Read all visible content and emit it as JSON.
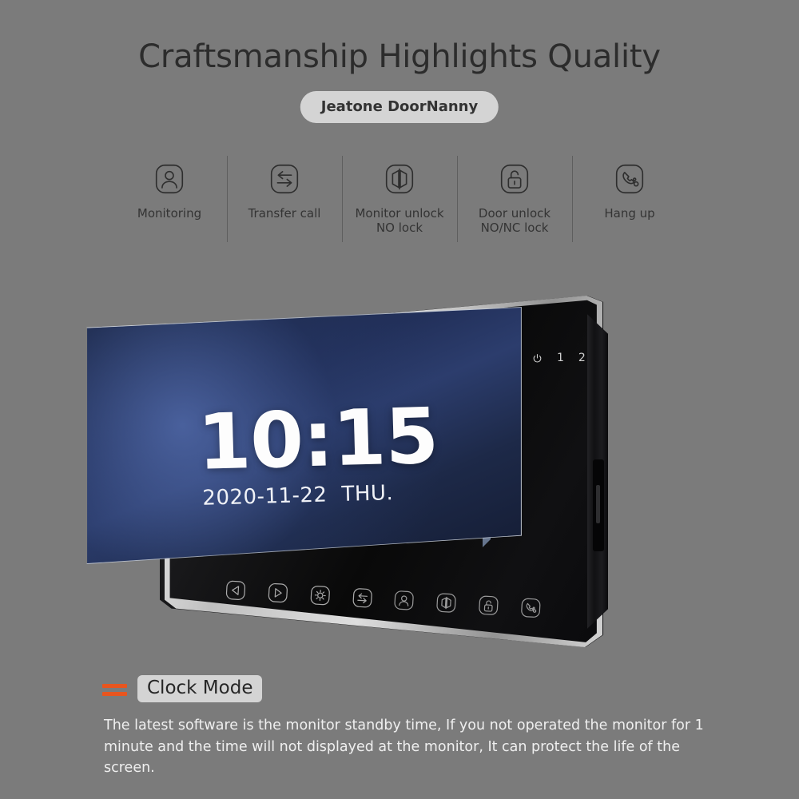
{
  "header": {
    "title": "Craftsmanship Highlights Quality",
    "badge": "Jeatone DoorNanny"
  },
  "features": [
    {
      "icon": "person-monitor-icon",
      "label": "Monitoring"
    },
    {
      "icon": "transfer-arrows-icon",
      "label": "Transfer call"
    },
    {
      "icon": "double-door-icon",
      "label": "Monitor unlock\nNO lock"
    },
    {
      "icon": "padlock-open-icon",
      "label": "Door unlock\nNO/NC lock"
    },
    {
      "icon": "phone-handset-icon",
      "label": "Hang up"
    }
  ],
  "device": {
    "screen": {
      "time": "10:15",
      "date": "2020-11-22",
      "day_of_week": "THU."
    },
    "indicators": {
      "power_icon": "power-icon",
      "channel_1": "1",
      "channel_2": "2"
    },
    "touch_buttons": [
      {
        "icon": "prev-arrow-icon",
        "label": "Previous"
      },
      {
        "icon": "next-arrow-icon",
        "label": "Next"
      },
      {
        "icon": "gear-icon",
        "label": "Settings"
      },
      {
        "icon": "transfer-arrows-icon",
        "label": "Transfer call"
      },
      {
        "icon": "person-monitor-icon",
        "label": "Monitoring"
      },
      {
        "icon": "double-door-icon",
        "label": "Monitor unlock"
      },
      {
        "icon": "padlock-open-icon",
        "label": "Door unlock"
      },
      {
        "icon": "phone-handset-icon",
        "label": "Hang up"
      }
    ]
  },
  "section": {
    "title": "Clock Mode",
    "marker_color": "#e8551f",
    "description": "The latest software is the monitor standby time,  If you not operated the monitor for 1 minute and the time will not displayed at the monitor, It can protect the life of the screen."
  },
  "colors": {
    "background": "#7b7b7b",
    "accent": "#e8551f",
    "badge_bg": "#d4d4d4",
    "screen_navy": "#22305a"
  }
}
